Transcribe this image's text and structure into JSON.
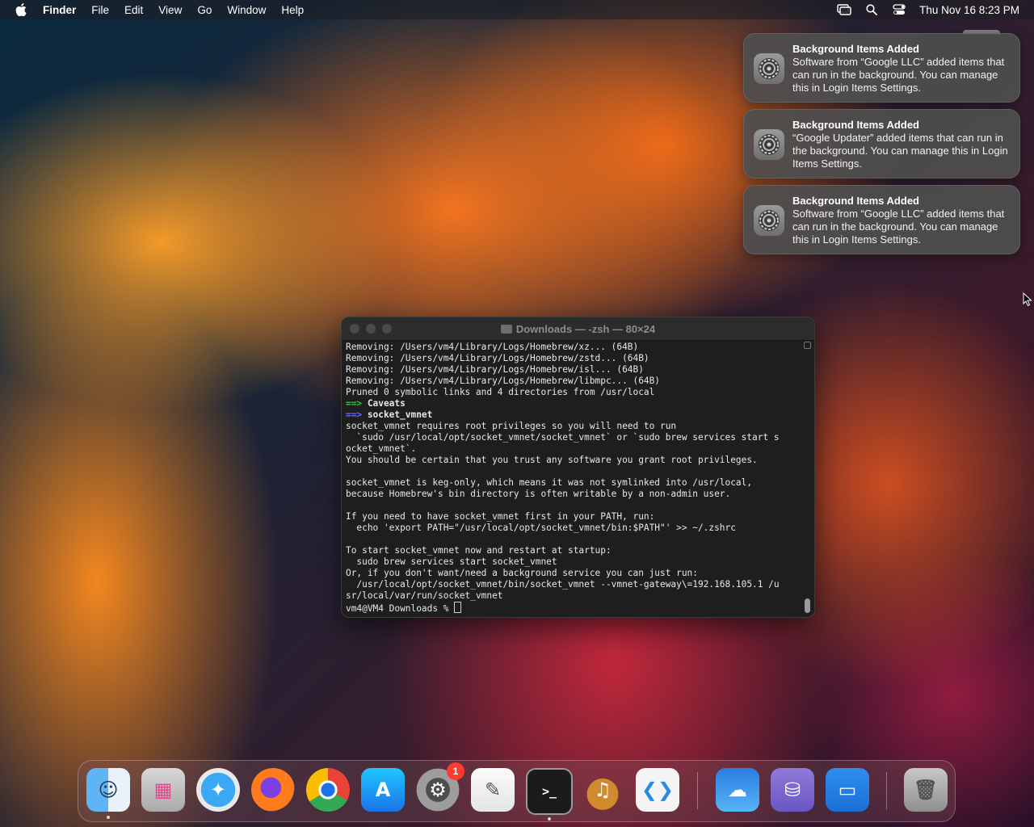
{
  "menubar": {
    "app_name": "Finder",
    "menus": [
      "File",
      "Edit",
      "View",
      "Go",
      "Window",
      "Help"
    ],
    "clock": "Thu Nov 16  8:23 PM",
    "status_icons": [
      "screen-mirroring-icon",
      "spotlight-search-icon",
      "control-center-icon"
    ]
  },
  "notifications": [
    {
      "title": "Background Items Added",
      "body": "Software from “Google LLC” added items that can run in the background. You can manage this in Login Items Settings.",
      "icon": "system-settings-gear-icon"
    },
    {
      "title": "Background Items Added",
      "body": "“Google Updater” added items that can run in the background. You can manage this in Login Items Settings.",
      "icon": "system-settings-gear-icon"
    },
    {
      "title": "Background Items Added",
      "body": "Software from “Google LLC” added items that can run in the background. You can manage this in Login Items Settings.",
      "icon": "system-settings-gear-icon"
    }
  ],
  "terminal": {
    "title": "Downloads — -zsh — 80×24",
    "lines": [
      "Removing: /Users/vm4/Library/Logs/Homebrew/xz... (64B)",
      "Removing: /Users/vm4/Library/Logs/Homebrew/zstd... (64B)",
      "Removing: /Users/vm4/Library/Logs/Homebrew/isl... (64B)",
      "Removing: /Users/vm4/Library/Logs/Homebrew/libmpc... (64B)",
      "Pruned 0 symbolic links and 4 directories from /usr/local",
      "==> Caveats",
      "==> socket_vmnet",
      "socket_vmnet requires root privileges so you will need to run",
      "  `sudo /usr/local/opt/socket_vmnet/socket_vmnet` or `sudo brew services start s",
      "ocket_vmnet`.",
      "You should be certain that you trust any software you grant root privileges.",
      "",
      "socket_vmnet is keg-only, which means it was not symlinked into /usr/local,",
      "because Homebrew's bin directory is often writable by a non-admin user.",
      "",
      "If you need to have socket_vmnet first in your PATH, run:",
      "  echo 'export PATH=\"/usr/local/opt/socket_vmnet/bin:$PATH\"' >> ~/.zshrc",
      "",
      "To start socket_vmnet now and restart at startup:",
      "  sudo brew services start socket_vmnet",
      "Or, if you don't want/need a background service you can just run:",
      "  /usr/local/opt/socket_vmnet/bin/socket_vmnet --vmnet-gateway\\=192.168.105.1 /u",
      "sr/local/var/run/socket_vmnet",
      "vm4@VM4 Downloads % "
    ],
    "arrow": "==>",
    "arrow_lines": {
      "5": "Caveats",
      "6": "socket_vmnet"
    }
  },
  "dock": {
    "items": [
      {
        "name": "Finder",
        "icon": "finder-icon",
        "running": true
      },
      {
        "name": "Launchpad",
        "icon": "launchpad-icon",
        "running": false
      },
      {
        "name": "Safari",
        "icon": "safari-icon",
        "running": false
      },
      {
        "name": "Firefox",
        "icon": "firefox-icon",
        "running": false
      },
      {
        "name": "Google Chrome",
        "icon": "chrome-icon",
        "running": false
      },
      {
        "name": "App Store",
        "icon": "app-store-icon",
        "running": false
      },
      {
        "name": "System Settings",
        "icon": "system-settings-icon",
        "running": false,
        "badge": "1"
      },
      {
        "name": "TextEdit",
        "icon": "textedit-icon",
        "running": false
      },
      {
        "name": "Terminal",
        "icon": "terminal-icon",
        "running": true
      },
      {
        "name": "GarageBand",
        "icon": "garageband-icon",
        "running": false
      },
      {
        "name": "Visual Studio Code",
        "icon": "vscode-icon",
        "running": false
      },
      {
        "name": "Weather",
        "icon": "weather-icon",
        "running": false
      },
      {
        "name": "Disk Utility",
        "icon": "disk-utility-icon",
        "running": false
      },
      {
        "name": "Keynote",
        "icon": "keynote-icon",
        "running": false
      },
      {
        "name": "Trash",
        "icon": "trash-icon",
        "running": false
      }
    ]
  }
}
